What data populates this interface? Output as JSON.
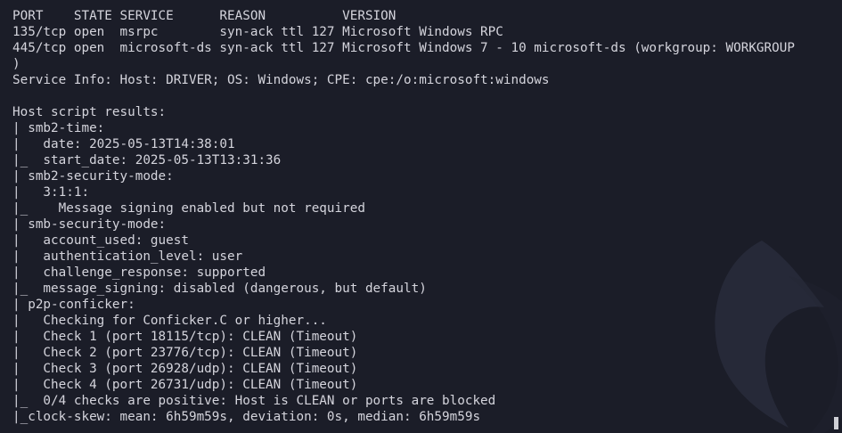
{
  "terminal": {
    "lines": [
      "PORT    STATE SERVICE      REASON          VERSION",
      "135/tcp open  msrpc        syn-ack ttl 127 Microsoft Windows RPC",
      "445/tcp open  microsoft-ds syn-ack ttl 127 Microsoft Windows 7 - 10 microsoft-ds (workgroup: WORKGROUP",
      ")",
      "Service Info: Host: DRIVER; OS: Windows; CPE: cpe:/o:microsoft:windows",
      "",
      "Host script results:",
      "| smb2-time:",
      "|   date: 2025-05-13T14:38:01",
      "|_  start_date: 2025-05-13T13:31:36",
      "| smb2-security-mode:",
      "|   3:1:1:",
      "|_    Message signing enabled but not required",
      "| smb-security-mode:",
      "|   account_used: guest",
      "|   authentication_level: user",
      "|   challenge_response: supported",
      "|_  message_signing: disabled (dangerous, but default)",
      "| p2p-conficker:",
      "|   Checking for Conficker.C or higher...",
      "|   Check 1 (port 18115/tcp): CLEAN (Timeout)",
      "|   Check 2 (port 23776/tcp): CLEAN (Timeout)",
      "|   Check 3 (port 26928/udp): CLEAN (Timeout)",
      "|   Check 4 (port 26731/udp): CLEAN (Timeout)",
      "|_  0/4 checks are positive: Host is CLEAN or ports are blocked",
      "|_clock-skew: mean: 6h59m59s, deviation: 0s, median: 6h59m59s"
    ]
  },
  "colors": {
    "background": "#1b1d28",
    "text": "#d4d4dc",
    "watermark": "#2a2d3b"
  },
  "icons": {
    "watermark": "dragon-watermark-icon"
  }
}
